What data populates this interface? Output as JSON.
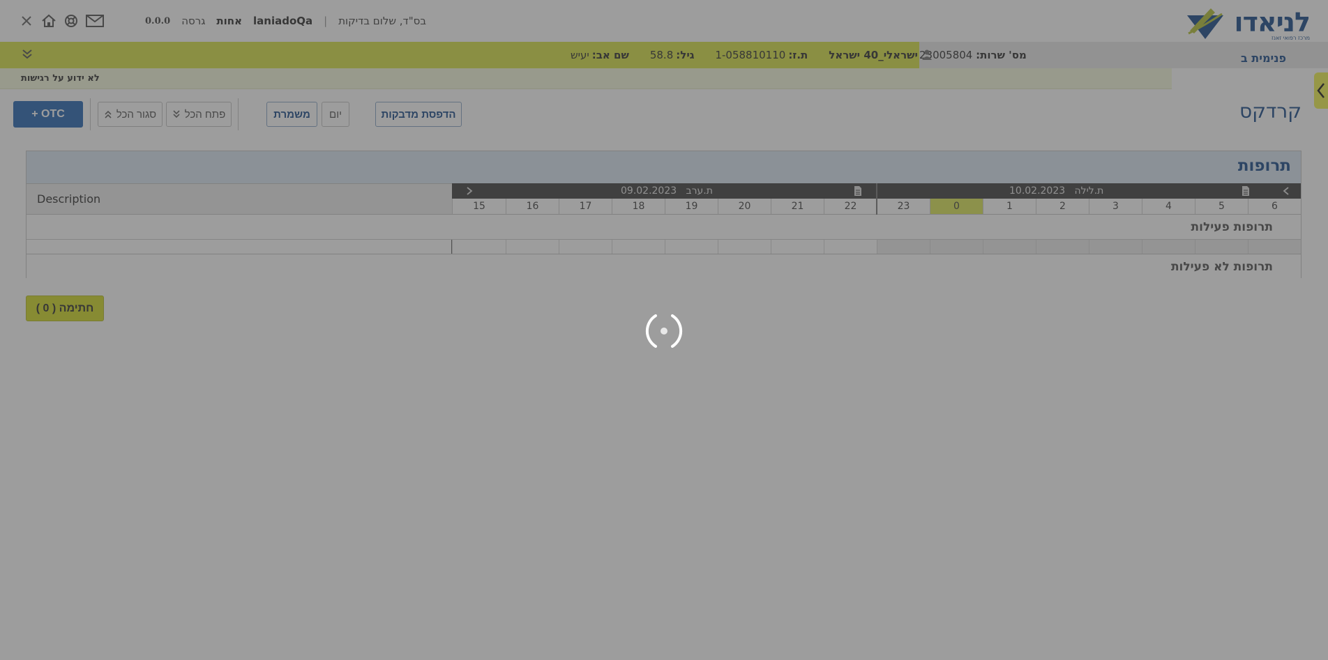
{
  "header": {
    "logo_text": "לניאדו",
    "logo_subtitle": "מרכז רפואי זאנז",
    "blessing": "בס\"ד, שלום",
    "user_name": "בדיקות",
    "username": "laniadoQa",
    "department": "אחות",
    "version_label": "גרסה",
    "version_number": "0.0.0",
    "icons": [
      "close-icon",
      "home-icon",
      "help-icon",
      "mail-icon"
    ]
  },
  "patient_bar": {
    "ward": "פנימית ב",
    "service_label": "מס' שרות:",
    "service_number": "23005804",
    "patient_name": "ישראלי_40 ישראל",
    "id_label": "ת.ז:",
    "id_value": "1-058810110",
    "age_label": "גיל:",
    "age_value": "58.8",
    "father_label": "שם אב:",
    "father_value": "יעיש",
    "allergy_text": "לא ידוע על רגישות"
  },
  "page": {
    "title": "קרדקס"
  },
  "toolbar": {
    "print_labels": "הדפסת מדבקות",
    "day": "יום",
    "shift": "משמרת",
    "expand_all": "פתח הכל",
    "collapse_all": "סגור הכל",
    "otc": "+ OTC"
  },
  "meds_panel": {
    "title": "תרופות",
    "description_label": "Description",
    "day_left": {
      "shift": "ת.ערב",
      "date": "09.02.2023"
    },
    "day_right": {
      "shift": "ת.לילה",
      "date": "10.02.2023"
    },
    "hours_left": [
      "22",
      "21",
      "20",
      "19",
      "18",
      "17",
      "16",
      "15"
    ],
    "hours_right": [
      "6",
      "5",
      "4",
      "3",
      "2",
      "1",
      "0",
      "23"
    ],
    "current_hour": "0",
    "active_section": "תרופות פעילות",
    "inactive_section": "תרופות לא פעילות"
  },
  "sign_button": "חתימה ( 0 )",
  "colors": {
    "brand_blue": "#1f4f8c",
    "accent_yellow": "#d8e24a",
    "overlay": "rgba(60,60,60,0.5)"
  }
}
